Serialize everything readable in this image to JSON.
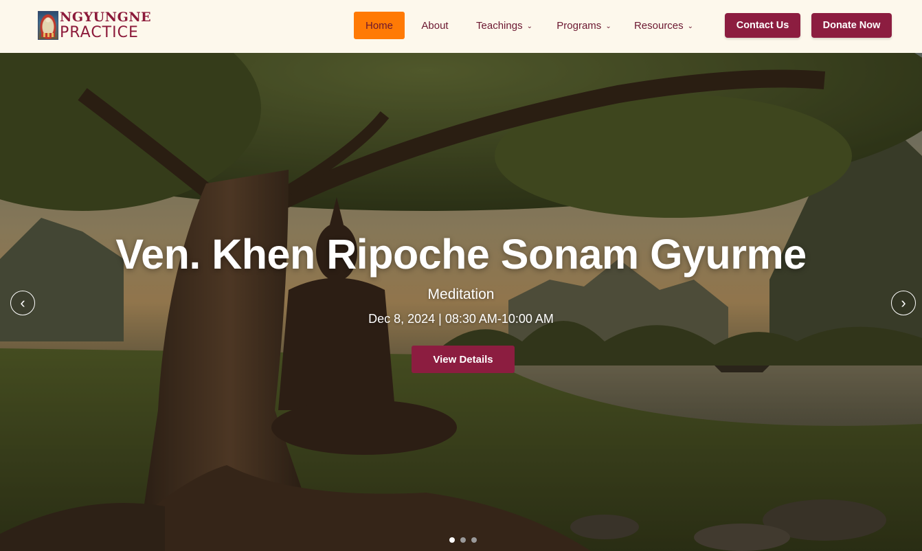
{
  "brand": {
    "line1": "NGYUNGNE",
    "line2": "PRACTICE",
    "maroon": "#8c1d40",
    "orange": "#ff7a05",
    "cream": "#fdf8ec"
  },
  "nav": {
    "items": [
      {
        "label": "Home",
        "active": true
      },
      {
        "label": "About"
      },
      {
        "label": "Teachings",
        "dropdown": true
      },
      {
        "label": "Programs",
        "dropdown": true
      },
      {
        "label": "Resources",
        "dropdown": true
      }
    ],
    "chevron": "⌄"
  },
  "header_buttons": {
    "contact": "Contact Us",
    "donate": "Donate Now"
  },
  "hero": {
    "title": "Ven. Khen Ripoche Sonam Gyurme",
    "subtitle": "Meditation",
    "date": "Dec 8, 2024 | 08:30 AM-10:00 AM",
    "cta": "View Details",
    "prev_icon": "‹",
    "next_icon": "›",
    "slides": 3,
    "active_slide": 1
  }
}
